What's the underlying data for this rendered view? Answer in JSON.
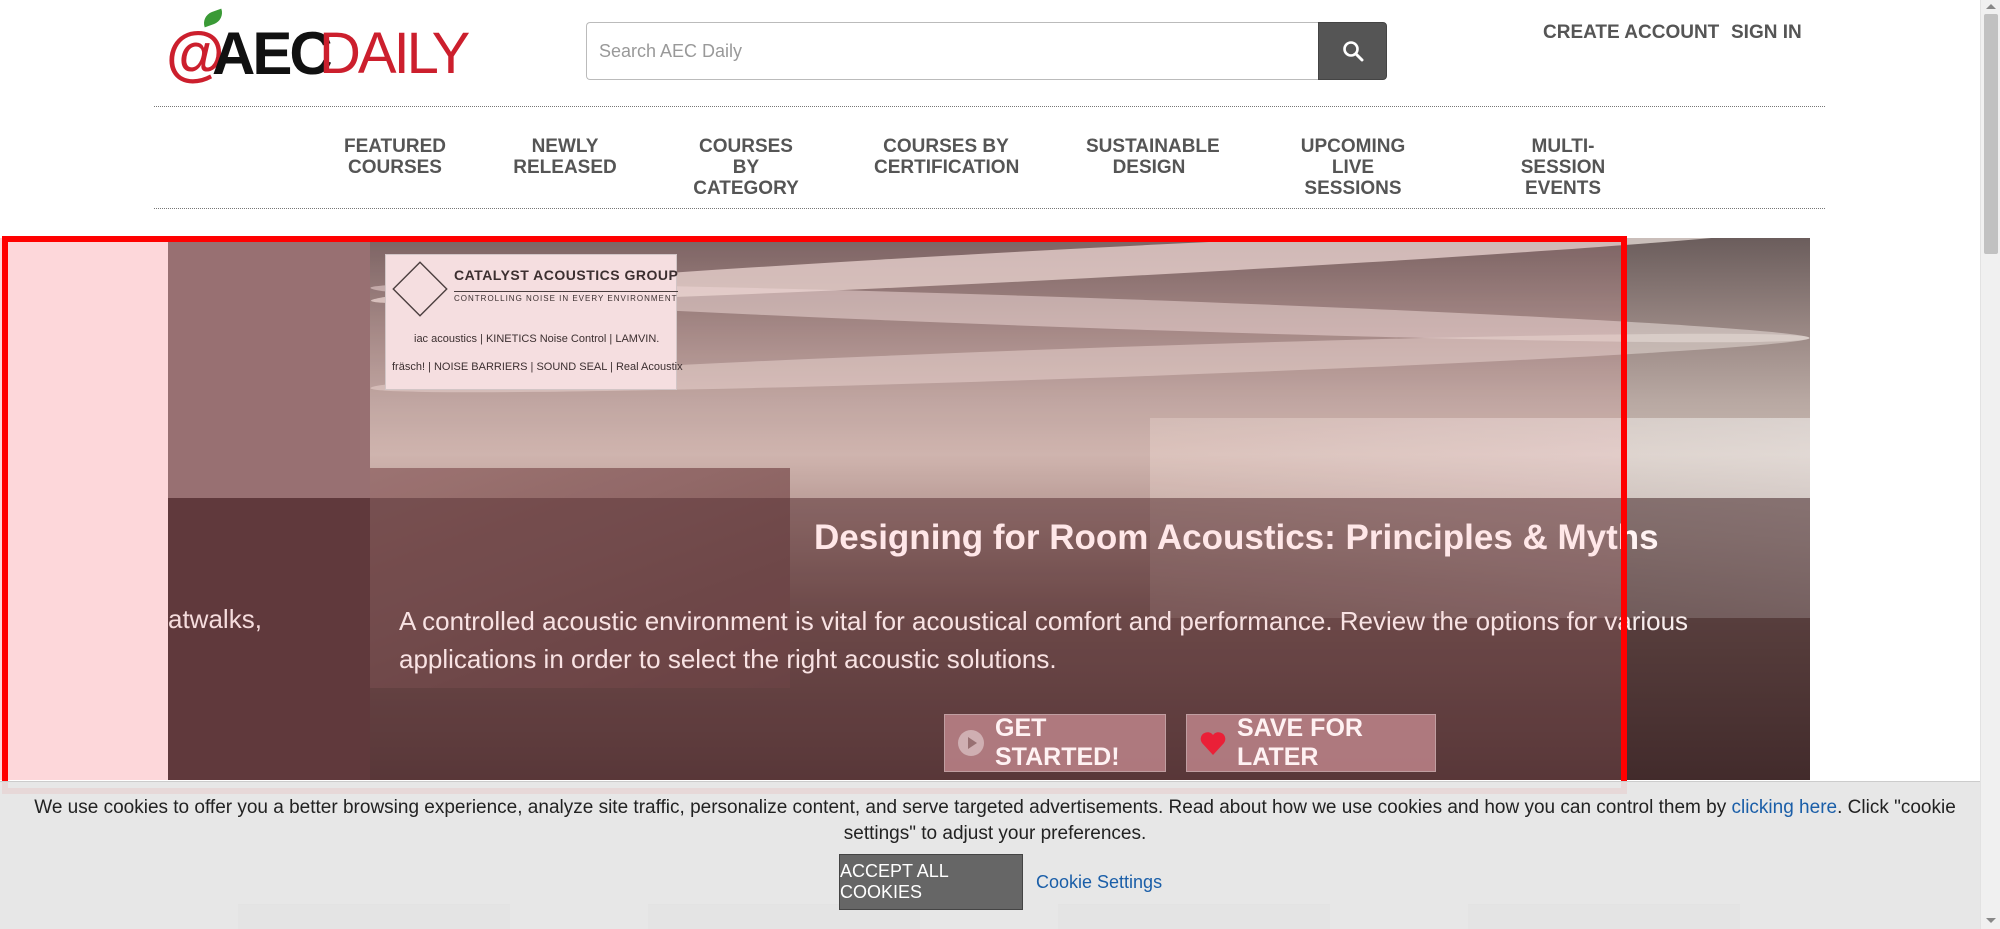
{
  "header": {
    "logo_text_at": "@",
    "logo_text_aec": "AEC",
    "logo_text_daily": "DAILY",
    "search_placeholder": "Search AEC Daily",
    "create_account": "CREATE ACCOUNT",
    "sign_in": "SIGN IN"
  },
  "nav": {
    "items": [
      {
        "line1": "FEATURED",
        "line2": "COURSES"
      },
      {
        "line1": "NEWLY",
        "line2": "RELEASED"
      },
      {
        "line1": "COURSES BY",
        "line2": "CATEGORY"
      },
      {
        "line1": "COURSES BY",
        "line2": "CERTIFICATION"
      },
      {
        "line1": "SUSTAINABLE",
        "line2": "DESIGN"
      },
      {
        "line1": "UPCOMING",
        "line2": "LIVE SESSIONS"
      },
      {
        "line1": "MULTI-SESSION",
        "line2": "EVENTS"
      }
    ]
  },
  "hero": {
    "prev_slide_fragment": "atwalks,",
    "sponsor": {
      "name": "CATALYST ACOUSTICS GROUP",
      "tagline": "CONTROLLING NOISE IN EVERY ENVIRONMENT",
      "brands_row1": "iac acoustics  |  KINETICS Noise Control  |  LAMVIN.",
      "brands_row2": "fräsch!  |  NOISE BARRIERS  |  SOUND SEAL  |  Real Acoustix"
    },
    "title": "Designing for Room Acoustics: Principles & Myths",
    "description": "A controlled acoustic environment is vital for acoustical comfort and performance. Review the options for various applications in order to select the right acoustic solutions.",
    "get_started": "GET STARTED!",
    "save_for_later": "SAVE FOR LATER"
  },
  "cookie": {
    "icon": "",
    "text_before": "We use cookies to offer you a better browsing experience, analyze site traffic, personalize content, and serve targeted advertisements. Read about how we use cookies and how you can control them by ",
    "link_text": "clicking here",
    "text_after": ". Click \"cookie settings\" to adjust your preferences.",
    "accept_all": "ACCEPT ALL COOKIES",
    "settings": "Cookie Settings"
  },
  "colors": {
    "brand_red": "#cc1f2d",
    "link_blue": "#1a5ea8",
    "highlight_frame": "#ff0000"
  }
}
